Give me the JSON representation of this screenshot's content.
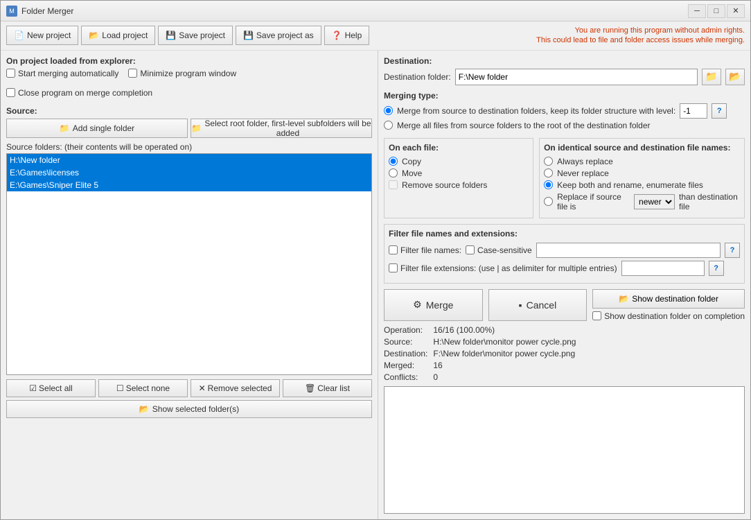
{
  "window": {
    "title": "Folder Merger",
    "icon": "M"
  },
  "toolbar": {
    "new_project": "New project",
    "load_project": "Load project",
    "save_project": "Save project",
    "save_project_as": "Save project as",
    "help": "Help",
    "warning_line1": "You are running this program without admin rights.",
    "warning_line2": "This could lead to file and folder access issues while merging."
  },
  "on_project": {
    "label": "On project loaded from explorer:",
    "start_merging": "Start merging automatically",
    "minimize_window": "Minimize program window",
    "close_program": "Close program on merge completion"
  },
  "source": {
    "label": "Source:",
    "add_single_folder": "Add single folder",
    "select_root_folder": "Select root folder, first-level subfolders will be added",
    "folder_list_label": "Source folders: (their contents will be operated on)",
    "folders": [
      "H:\\New folder",
      "E:\\Games\\licenses",
      "E:\\Games\\Sniper Elite 5"
    ]
  },
  "bottom_buttons": {
    "select_all": "Select all",
    "select_none": "Select none",
    "remove_selected": "Remove selected",
    "clear_list": "Clear list",
    "show_selected_folders": "Show selected folder(s)"
  },
  "destination": {
    "label": "Destination:",
    "folder_label": "Destination folder:",
    "folder_value": "F:\\New folder"
  },
  "merging_type": {
    "label": "Merging type:",
    "option1": "Merge from source to destination folders, keep its folder structure with level:",
    "option2": "Merge all files from source folders to the root of the destination folder",
    "level_value": "-1"
  },
  "each_file": {
    "label": "On each file:",
    "copy": "Copy",
    "move": "Move",
    "remove_source": "Remove source folders"
  },
  "identical_files": {
    "label": "On identical source and destination file names:",
    "always_replace": "Always replace",
    "never_replace": "Never replace",
    "keep_both": "Keep both and rename, enumerate files",
    "replace_if": "Replace if source file is",
    "newer": "newer",
    "than_dest": "than destination file"
  },
  "filter": {
    "label": "Filter file names and extensions:",
    "filter_names": "Filter file names:",
    "case_sensitive": "Case-sensitive",
    "filter_extensions_label": "Filter file extensions: (use | as delimiter for multiple entries)"
  },
  "merge_action": {
    "merge_label": "Merge",
    "cancel_label": "Cancel",
    "show_dest_folder": "Show destination folder",
    "show_dest_on_completion": "Show destination folder on completion"
  },
  "status": {
    "operation_label": "Operation:",
    "operation_value": "16/16 (100.00%)",
    "source_label": "Source:",
    "source_value": "H:\\New folder\\monitor power cycle.png",
    "destination_label": "Destination:",
    "destination_value": "F:\\New folder\\monitor power cycle.png",
    "merged_label": "Merged:",
    "merged_value": "16",
    "conflicts_label": "Conflicts:",
    "conflicts_value": "0"
  },
  "icons": {
    "folder": "📁",
    "save": "💾",
    "help": "❓",
    "merge": "⚙",
    "cancel": "▪",
    "show_folder": "📂",
    "arrow": "→",
    "select_all": "☑",
    "select_none": "☐",
    "remove": "✕",
    "clear": "🗑"
  }
}
